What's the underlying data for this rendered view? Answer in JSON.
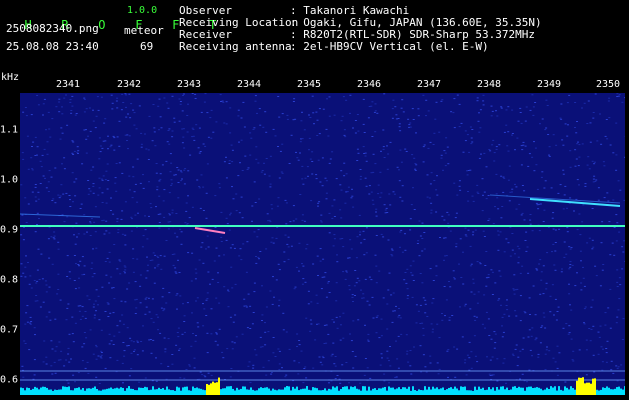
{
  "app": {
    "title_letters": [
      "H",
      "R",
      "O",
      "F",
      "F",
      "T"
    ],
    "version": "1.0.0",
    "filename": "2508082340.png",
    "timestamp": "25.08.08 23:40",
    "meteor_label": "meteor",
    "meteor_count": "69"
  },
  "info": [
    {
      "label": "Observer",
      "value": ": Takanori Kawachi"
    },
    {
      "label": "Receiving Location",
      "value": ": Ogaki, Gifu, JAPAN (136.60E, 35.35N)"
    },
    {
      "label": "Receiver",
      "value": ": R820T2(RTL-SDR) SDR-Sharp 53.372MHz"
    },
    {
      "label": "Receiving antenna",
      "value": ": 2el-HB9CV Vertical (el. E-W)"
    }
  ],
  "axes": {
    "y_unit": "kHz",
    "y_ticks": [
      "1.1",
      "1.0",
      "0.9",
      "0.8",
      "0.7",
      "0.6"
    ],
    "x_ticks": [
      "2341",
      "2342",
      "2343",
      "2344",
      "2345",
      "2346",
      "2347",
      "2348",
      "2349",
      "2350"
    ]
  },
  "colors": {
    "background": "#0a1078",
    "carrier": "#40ffc0",
    "text_green": "#39ff39",
    "spectrum": "#00e0ff",
    "spike": "#ffff00"
  }
}
